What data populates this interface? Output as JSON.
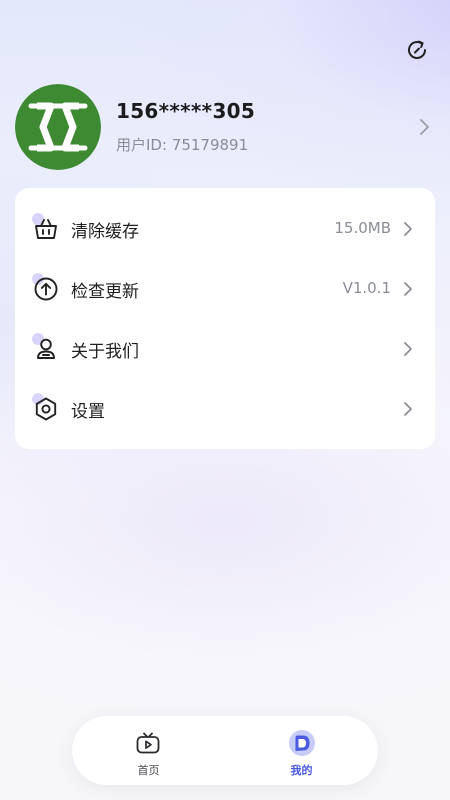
{
  "colors": {
    "accent": "#4b5ae0",
    "card_bg": "#ffffff",
    "text_primary": "#1f1f22",
    "text_secondary": "#8a8d95",
    "avatar_bg": "#3e8a33"
  },
  "header": {
    "refresh_icon": "refresh-icon"
  },
  "profile": {
    "avatar_icon": "avatar-logo",
    "phone": "156*****305",
    "uid_label": "用户ID: ",
    "uid": "75179891",
    "chevron_icon": "chevron-right-icon"
  },
  "menu": {
    "items": [
      {
        "icon": "basket-icon",
        "label": "清除缓存",
        "value": "15.0MB"
      },
      {
        "icon": "upload-icon",
        "label": "检查更新",
        "value": "V1.0.1"
      },
      {
        "icon": "user-icon",
        "label": "关于我们",
        "value": ""
      },
      {
        "icon": "hexagon-settings-icon",
        "label": "设置",
        "value": ""
      }
    ]
  },
  "tabbar": {
    "tabs": [
      {
        "icon": "tv-icon",
        "label": "首页",
        "active": false
      },
      {
        "icon": "profile-bubble-icon",
        "label": "我的",
        "active": true
      }
    ]
  }
}
